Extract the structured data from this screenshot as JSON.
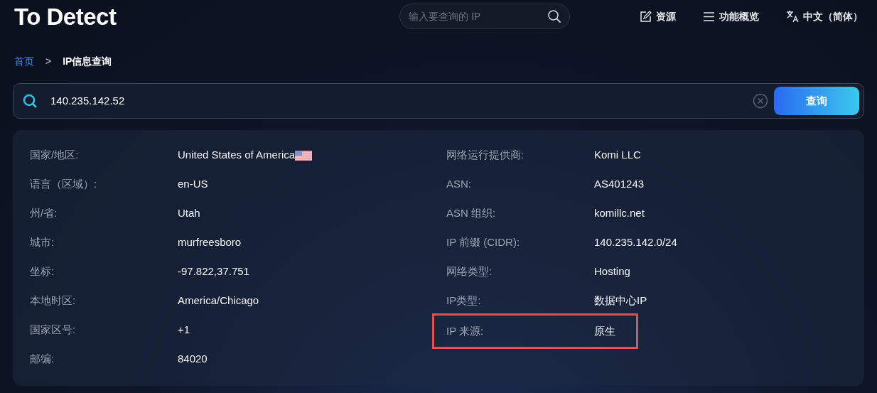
{
  "header": {
    "logo": "To Detect",
    "search": {
      "placeholder": "输入要查询的 IP"
    },
    "nav": [
      {
        "kind": "resources",
        "label": "资源"
      },
      {
        "kind": "features",
        "label": "功能概览"
      },
      {
        "kind": "language",
        "label": "中文（简体）"
      }
    ]
  },
  "breadcrumb": [
    {
      "label": "首页",
      "kind": "link"
    },
    {
      "label": ">",
      "kind": "separator"
    },
    {
      "label": "IP信息查询",
      "kind": "current"
    }
  ],
  "query": {
    "value": "140.235.142.52",
    "button": "查询"
  },
  "info": {
    "columns": [
      [
        {
          "label": "国家/地区:",
          "value": "United States of America",
          "flag": true,
          "highlighted": false
        },
        {
          "label": "语言（区域）:",
          "value": "en-US",
          "flag": false,
          "highlighted": false
        },
        {
          "label": "州/省:",
          "value": "Utah",
          "flag": false,
          "highlighted": false
        },
        {
          "label": "城市:",
          "value": "murfreesboro",
          "flag": false,
          "highlighted": false
        },
        {
          "label": "坐标:",
          "value": "-97.822,37.751",
          "flag": false,
          "highlighted": false
        },
        {
          "label": "本地时区:",
          "value": "America/Chicago",
          "flag": false,
          "highlighted": false
        },
        {
          "label": "国家区号:",
          "value": "+1",
          "flag": false,
          "highlighted": false
        },
        {
          "label": "邮编:",
          "value": "84020",
          "flag": false,
          "highlighted": false
        }
      ],
      [
        {
          "label": "网络运行提供商:",
          "value": "Komi LLC",
          "flag": false,
          "highlighted": false
        },
        {
          "label": "ASN:",
          "value": "AS401243",
          "flag": false,
          "highlighted": false
        },
        {
          "label": "ASN 组织:",
          "value": "komillc.net",
          "flag": false,
          "highlighted": false
        },
        {
          "label": "IP 前缀 (CIDR):",
          "value": "140.235.142.0/24",
          "flag": false,
          "highlighted": false
        },
        {
          "label": "网络类型:",
          "value": "Hosting",
          "flag": false,
          "highlighted": false
        },
        {
          "label": "IP类型:",
          "value": "数据中心IP",
          "flag": false,
          "highlighted": false
        },
        {
          "label": "IP 来源:",
          "value": "原生",
          "flag": false,
          "highlighted": true
        }
      ]
    ]
  }
}
